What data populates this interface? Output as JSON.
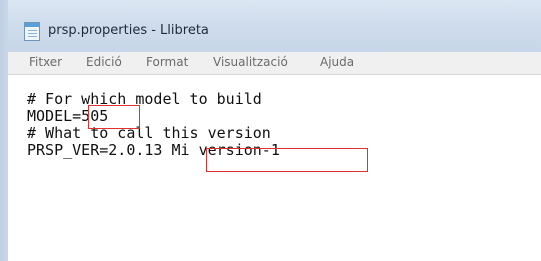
{
  "window": {
    "title": "prsp.properties - Llibreta",
    "icon": "notepad-icon"
  },
  "menu": [
    {
      "label": "Fitxer"
    },
    {
      "label": "Edició"
    },
    {
      "label": "Format"
    },
    {
      "label": "Visualització"
    },
    {
      "label": "Ajuda"
    }
  ],
  "editor": {
    "lines": [
      "# For which model to build",
      "MODEL=505",
      "# What to call this version",
      "PRSP_VER=2.0.13 Mi version-1"
    ]
  },
  "annotations": {
    "highlight_color": "#e0302f"
  }
}
